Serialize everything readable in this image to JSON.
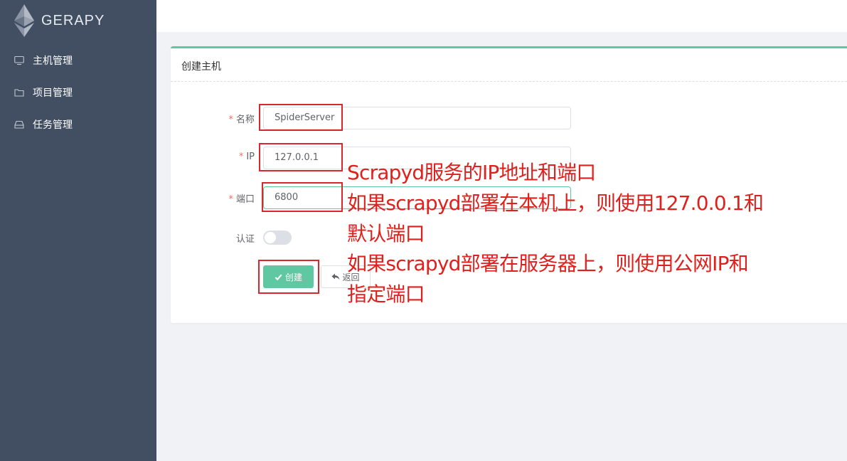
{
  "brand": {
    "name": "GERAPY"
  },
  "sidebar": {
    "items": [
      {
        "label": "主机管理",
        "icon": "monitor-icon"
      },
      {
        "label": "项目管理",
        "icon": "folder-icon"
      },
      {
        "label": "任务管理",
        "icon": "inbox-icon"
      }
    ]
  },
  "panel": {
    "title": "创建主机"
  },
  "form": {
    "name": {
      "label": "名称",
      "required": true,
      "value": "SpiderServer"
    },
    "ip": {
      "label": "IP",
      "required": true,
      "value": "127.0.0.1"
    },
    "port": {
      "label": "端口",
      "required": true,
      "value": "6800"
    },
    "auth": {
      "label": "认证",
      "enabled": false
    },
    "create_label": "创建",
    "back_label": "返回"
  },
  "annotation": {
    "lines": [
      "Scrapyd服务的IP地址和端口",
      "如果scrapyd部署在本机上，则使用127.0.0.1和",
      "默认端口",
      "如果scrapyd部署在服务器上，则使用公网IP和",
      "指定端口"
    ]
  },
  "colors": {
    "sidebar": "#424f63",
    "accent": "#5fc8a2",
    "annotation": "#e0201c",
    "required": "#f56c6c"
  }
}
